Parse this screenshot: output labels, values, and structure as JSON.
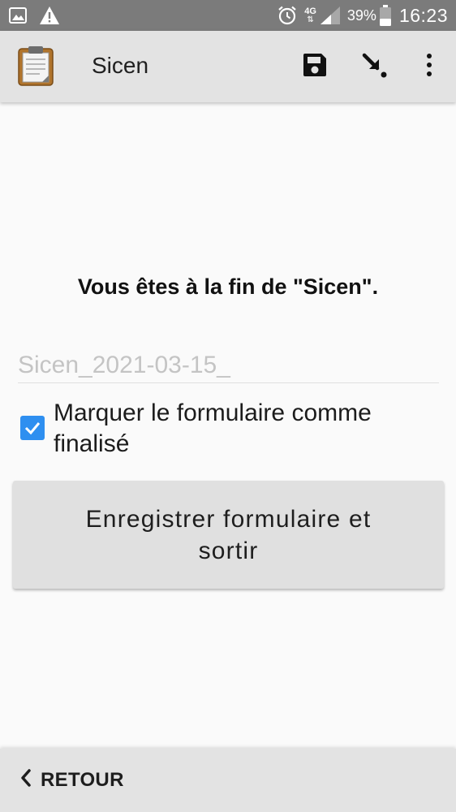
{
  "status_bar": {
    "left_icons": [
      "image-icon",
      "warning-icon"
    ],
    "right_icons": [
      "alarm-icon",
      "signal-icon",
      "battery-icon"
    ],
    "network": "4G",
    "battery_percent": "39%",
    "time": "16:23"
  },
  "app_bar": {
    "title": "Sicen",
    "logo_icon": "clipboard-icon",
    "actions": [
      "save-icon",
      "jump-arrow-icon",
      "more-vert-icon"
    ]
  },
  "main": {
    "end_message": "Vous êtes à la fin de \"Sicen\".",
    "form_name_value": "Sicen_2021-03-15_",
    "finalize_label": "Marquer le formulaire comme finalisé",
    "finalize_checked": true,
    "save_button_label": "Enregistrer formulaire et sortir"
  },
  "bottom_nav": {
    "back_label": "RETOUR",
    "back_icon": "chevron-left-icon"
  },
  "colors": {
    "status_bar": "#7b7b7b",
    "app_bar": "#e3e3e3",
    "checkbox": "#2e8ff0",
    "background": "#fafafa"
  }
}
